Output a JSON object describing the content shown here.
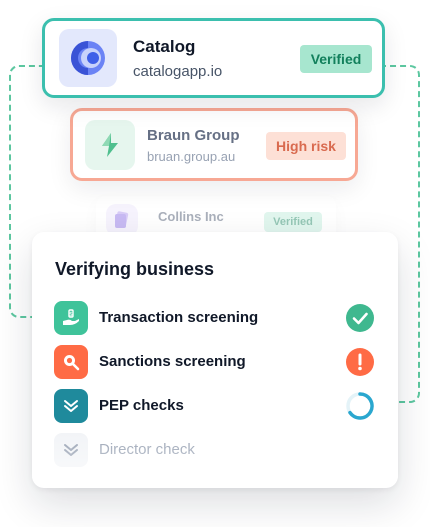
{
  "colors": {
    "accent_teal": "#3bbfae",
    "verified_green": "#12805c",
    "risk_orange": "#f7a894",
    "error_orange": "#ff6b45"
  },
  "businesses": [
    {
      "name": "Catalog",
      "domain": "catalogapp.io",
      "status": "Verified",
      "logo_icon": "catalog-logo-icon"
    },
    {
      "name": "Braun Group",
      "domain": "bruan.group.au",
      "status": "High risk",
      "logo_icon": "braun-logo-icon"
    },
    {
      "name": "Collins Inc",
      "status": "Verified",
      "logo_icon": "collins-logo-icon"
    }
  ],
  "verification": {
    "title": "Verifying business",
    "checks": [
      {
        "label": "Transaction screening",
        "icon": "money-hand-icon",
        "status": "passed",
        "status_icon": "check-circle-icon"
      },
      {
        "label": "Sanctions screening",
        "icon": "search-icon",
        "status": "warning",
        "status_icon": "exclamation-circle-icon"
      },
      {
        "label": "PEP checks",
        "icon": "checklist-icon",
        "status": "in-progress",
        "status_icon": "loading-spinner-icon"
      },
      {
        "label": "Director check",
        "icon": "checklist-icon",
        "status": "pending"
      }
    ]
  }
}
